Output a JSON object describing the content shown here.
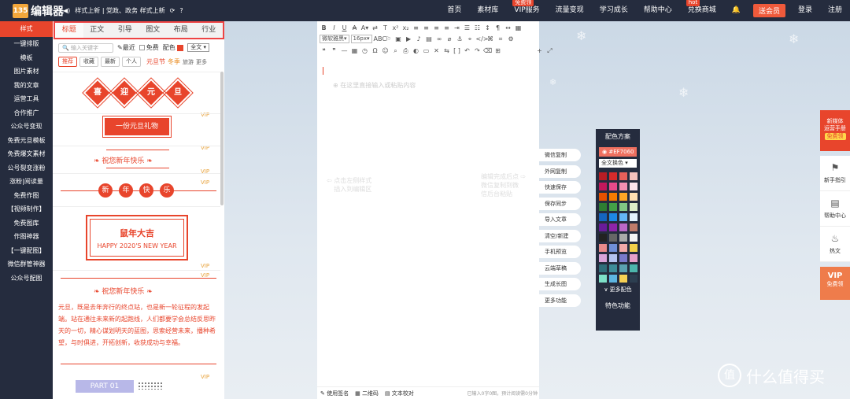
{
  "header": {
    "logo_mark": "135",
    "logo_text": "编辑器",
    "notice": "样式上新 | 党政、政务 样式上新",
    "nav": [
      {
        "label": "首页"
      },
      {
        "label": "素材库"
      },
      {
        "label": "VIP服务",
        "badge": "免费领"
      },
      {
        "label": "流量变现"
      },
      {
        "label": "学习成长"
      },
      {
        "label": "帮助中心"
      },
      {
        "label": "兑换商城",
        "badge": "hot"
      }
    ],
    "send_vip": "送会员",
    "login": "登录",
    "register": "注册"
  },
  "sidebar": {
    "items": [
      "样式",
      "一键排版",
      "模板",
      "图片素材",
      "我的文章",
      "运营工具",
      "合作推广",
      "公众号变现",
      "免费元旦模板",
      "免费爆文素材",
      "公号裂变涨粉",
      "涨粉|阅读量",
      "免费作图",
      "【视频制作】",
      "免费图库",
      "作图神器",
      "【一键配图】",
      "微信群管神器",
      "公众号配图"
    ]
  },
  "panel": {
    "tabs": [
      "标题",
      "正文",
      "引导",
      "图文",
      "布局",
      "行业"
    ],
    "search_placeholder": "输入关键字",
    "recent": "最近",
    "free": "免费",
    "color_label": "配色",
    "color_select": "全文",
    "filters": [
      "推荐",
      "收藏",
      "最新",
      "个人"
    ],
    "tag_red": "元旦节",
    "tag_orange": "冬季",
    "tag_more": "旅游",
    "more": "更多",
    "vip": "VIP",
    "diamond_chars": [
      "喜",
      "迎",
      "元",
      "旦"
    ],
    "gift": "一份元旦礼物",
    "wish1": "祝您新年快乐",
    "circle_chars": [
      "新",
      "年",
      "快",
      "乐"
    ],
    "frame_title": "鼠年大吉",
    "frame_sub": "HAPPY 2020'S NEW YEAR",
    "wish2": "祝您新年快乐",
    "paragraph": "元旦，既是去年奔行的终点站，也是新一轮征程的发起端。站在通往未来新的起跑线，人们都要学会总结反思昨天的一切，精心谋划明天的蓝图，思索经营未来，播种希望，与时俱进，开拓创新，收获成功与幸福。",
    "part_label": "PART 01"
  },
  "editor": {
    "font": "微软雅黑",
    "size": "16px",
    "placeholder": "在这里直接输入或粘贴内容",
    "hint_left": "点击左侧样式\n插入到编辑区",
    "hint_right": "编辑完成后点\n微信复制到微\n信后台粘贴",
    "footer": {
      "sign": "使用签名",
      "qrcode": "二维码",
      "proof": "文本校对",
      "status": "已输入0字0图，预计阅读需0分钟"
    }
  },
  "actions": [
    "微信复制",
    "外网复制",
    "快速保存",
    "保存同步",
    "导入文章",
    "清空/新建",
    "手机预览",
    "云端草稿",
    "生成长图",
    "更多功能"
  ],
  "color_scheme": {
    "title": "配色方案",
    "hex": "#EF7060",
    "select": "全文换色",
    "swatches": [
      "#b81d24",
      "#d62b2b",
      "#e8605a",
      "#f6c2bd",
      "#c2185b",
      "#e64a8a",
      "#f48fb1",
      "#fce4ec",
      "#e65100",
      "#f57c00",
      "#ffa726",
      "#ffe0b2",
      "#2e7d32",
      "#43a047",
      "#81c784",
      "#dcedc8",
      "#1565c0",
      "#1e88e5",
      "#64b5f6",
      "#e3f2fd",
      "#6a1b9a",
      "#8e24aa",
      "#ba68c8",
      "#bf7b6a",
      "#222222",
      "#666666",
      "#aaaaaa",
      "#f5f5f5",
      "#e88a8a",
      "#6f8fd8",
      "#f2a9a9",
      "#f2d04a",
      "#d9a4d9",
      "#b4c4f0",
      "#7a7acb",
      "#e6a0c8",
      "#2f6e7a",
      "#3e8e9a",
      "#5aa2b0",
      "#4db6ac",
      "#7ee0c8",
      "#5db5e0",
      "#f7d154",
      "#2c3e50"
    ],
    "more": "更多配色",
    "special": "特色功能"
  },
  "float_bar": {
    "promo_line1": "新媒体",
    "promo_line2": "运营手册",
    "promo_free": "免费领",
    "items": [
      {
        "icon": "flag-icon",
        "label": "新手指引"
      },
      {
        "icon": "doc-icon",
        "label": "帮助中心"
      },
      {
        "icon": "fire-icon",
        "label": "热文"
      }
    ],
    "vip_title": "VIP",
    "vip_label": "免费领"
  },
  "watermark": "什么值得买",
  "watermark_mark": "值"
}
